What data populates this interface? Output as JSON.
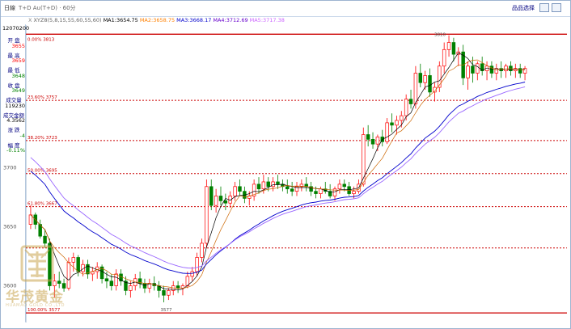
{
  "window": {
    "title_left": "日線",
    "instrument": "T+D  Au(T+D) · 60分",
    "buttons": [
      "品品选择"
    ]
  },
  "sidebar": {
    "date": "12070200",
    "fields": [
      {
        "label": "开 盘",
        "value": "3655",
        "color": "#ff0000"
      },
      {
        "label": "最 高",
        "value": "3659",
        "color": "#ff0000"
      },
      {
        "label": "最 低",
        "value": "3648",
        "color": "#008000"
      },
      {
        "label": "收 盘",
        "value": "3649",
        "color": "#008000"
      },
      {
        "label": "成交量",
        "value": "119230",
        "color": "#000000"
      },
      {
        "label": "成交金额",
        "value": "4.3562",
        "color": "#000000"
      },
      {
        "label": "涨 跌",
        "value": "-4",
        "color": "#008000"
      },
      {
        "label": "幅 度",
        "value": "-0.11%",
        "color": "#008000"
      }
    ]
  },
  "ma_legend": [
    {
      "text": "X",
      "color": "#888888"
    },
    {
      "text": "XYZ8(5,8,15,55,60,55,60)",
      "color": "#666666"
    },
    {
      "text": "MA1:3654.75",
      "color": "#000000"
    },
    {
      "text": "MA2:3658.75",
      "color": "#ff8000"
    },
    {
      "text": "MA3:3668.17",
      "color": "#0000cc"
    },
    {
      "text": "MA4:3712.69",
      "color": "#6600cc"
    },
    {
      "text": "MA5:3717.38",
      "color": "#cc66ff"
    }
  ],
  "watermark": {
    "cn": "华茂黄金",
    "en": "HUAMAO GOLD CO.,LTD"
  },
  "chart_data": {
    "type": "candlestick",
    "ylim": [
      3573,
      3818
    ],
    "yticks": [
      {
        "value": 3700,
        "label": "3700"
      },
      {
        "value": 3650,
        "label": "3650"
      },
      {
        "value": 3600,
        "label": "3600"
      }
    ],
    "high_label": {
      "value": 3810,
      "label": "3810"
    },
    "low_label": {
      "value": 3577,
      "label": "3577"
    },
    "fib_levels": [
      {
        "label": "0.00% 3813",
        "value": 3813,
        "color": "#cc0000"
      },
      {
        "label": "23.60% 3757",
        "value": 3757,
        "color": "#cc0000"
      },
      {
        "label": "38.20% 3723",
        "value": 3723,
        "color": "#cc0000"
      },
      {
        "label": "50.00% 3695",
        "value": 3695,
        "color": "#cc0000"
      },
      {
        "label": "61.80% 3667",
        "value": 3667,
        "color": "#cc0000"
      },
      {
        "label": "100.00% 3577",
        "value": 3577,
        "color": "#cc0000"
      }
    ],
    "grid_lines": [
      3632
    ],
    "colors": {
      "up": "#ff0000",
      "down": "#008000",
      "ma_short": "#000000",
      "ma_mid": "#cc6600",
      "ma_long": "#0000cc",
      "ma_longer": "#9966ff"
    },
    "candles": [
      [
        3652,
        3668,
        3648,
        3660
      ],
      [
        3660,
        3662,
        3648,
        3652
      ],
      [
        3652,
        3656,
        3640,
        3642
      ],
      [
        3642,
        3648,
        3632,
        3636
      ],
      [
        3636,
        3640,
        3596,
        3600
      ],
      [
        3600,
        3610,
        3590,
        3604
      ],
      [
        3604,
        3612,
        3598,
        3602
      ],
      [
        3602,
        3606,
        3595,
        3598
      ],
      [
        3598,
        3624,
        3596,
        3620
      ],
      [
        3620,
        3628,
        3612,
        3624
      ],
      [
        3624,
        3626,
        3608,
        3612
      ],
      [
        3612,
        3622,
        3608,
        3618
      ],
      [
        3618,
        3622,
        3606,
        3610
      ],
      [
        3610,
        3616,
        3604,
        3612
      ],
      [
        3612,
        3620,
        3606,
        3616
      ],
      [
        3616,
        3618,
        3602,
        3606
      ],
      [
        3606,
        3612,
        3598,
        3604
      ],
      [
        3604,
        3610,
        3596,
        3600
      ],
      [
        3600,
        3614,
        3596,
        3610
      ],
      [
        3610,
        3614,
        3600,
        3604
      ],
      [
        3604,
        3608,
        3592,
        3596
      ],
      [
        3596,
        3604,
        3590,
        3600
      ],
      [
        3600,
        3610,
        3596,
        3606
      ],
      [
        3606,
        3612,
        3598,
        3602
      ],
      [
        3602,
        3606,
        3594,
        3598
      ],
      [
        3598,
        3606,
        3594,
        3602
      ],
      [
        3602,
        3608,
        3596,
        3600
      ],
      [
        3600,
        3604,
        3590,
        3596
      ],
      [
        3596,
        3600,
        3586,
        3592
      ],
      [
        3592,
        3598,
        3588,
        3596
      ],
      [
        3596,
        3604,
        3592,
        3600
      ],
      [
        3600,
        3604,
        3594,
        3598
      ],
      [
        3598,
        3602,
        3592,
        3600
      ],
      [
        3600,
        3612,
        3598,
        3608
      ],
      [
        3608,
        3616,
        3604,
        3612
      ],
      [
        3612,
        3628,
        3608,
        3624
      ],
      [
        3624,
        3640,
        3620,
        3636
      ],
      [
        3636,
        3690,
        3632,
        3684
      ],
      [
        3684,
        3690,
        3664,
        3668
      ],
      [
        3668,
        3682,
        3662,
        3676
      ],
      [
        3676,
        3684,
        3668,
        3672
      ],
      [
        3672,
        3678,
        3664,
        3670
      ],
      [
        3670,
        3680,
        3666,
        3676
      ],
      [
        3676,
        3688,
        3672,
        3684
      ],
      [
        3684,
        3690,
        3676,
        3680
      ],
      [
        3680,
        3684,
        3670,
        3674
      ],
      [
        3674,
        3680,
        3668,
        3676
      ],
      [
        3676,
        3690,
        3672,
        3686
      ],
      [
        3686,
        3692,
        3678,
        3682
      ],
      [
        3682,
        3694,
        3678,
        3688
      ],
      [
        3688,
        3692,
        3680,
        3684
      ],
      [
        3684,
        3692,
        3680,
        3688
      ],
      [
        3688,
        3694,
        3682,
        3686
      ],
      [
        3686,
        3690,
        3680,
        3684
      ],
      [
        3684,
        3690,
        3678,
        3682
      ],
      [
        3682,
        3688,
        3676,
        3680
      ],
      [
        3680,
        3688,
        3676,
        3684
      ],
      [
        3684,
        3690,
        3680,
        3686
      ],
      [
        3686,
        3692,
        3680,
        3684
      ],
      [
        3684,
        3688,
        3676,
        3680
      ],
      [
        3680,
        3684,
        3674,
        3678
      ],
      [
        3678,
        3684,
        3674,
        3682
      ],
      [
        3682,
        3688,
        3678,
        3680
      ],
      [
        3680,
        3686,
        3674,
        3676
      ],
      [
        3676,
        3684,
        3672,
        3682
      ],
      [
        3682,
        3690,
        3678,
        3686
      ],
      [
        3686,
        3690,
        3680,
        3684
      ],
      [
        3684,
        3688,
        3676,
        3678
      ],
      [
        3678,
        3684,
        3674,
        3680
      ],
      [
        3680,
        3690,
        3678,
        3686
      ],
      [
        3686,
        3734,
        3684,
        3728
      ],
      [
        3728,
        3736,
        3718,
        3724
      ],
      [
        3724,
        3730,
        3716,
        3720
      ],
      [
        3720,
        3728,
        3714,
        3726
      ],
      [
        3726,
        3732,
        3718,
        3722
      ],
      [
        3722,
        3742,
        3720,
        3738
      ],
      [
        3738,
        3746,
        3730,
        3736
      ],
      [
        3736,
        3744,
        3728,
        3740
      ],
      [
        3740,
        3748,
        3734,
        3744
      ],
      [
        3744,
        3762,
        3740,
        3758
      ],
      [
        3758,
        3766,
        3750,
        3754
      ],
      [
        3754,
        3786,
        3750,
        3780
      ],
      [
        3780,
        3788,
        3768,
        3772
      ],
      [
        3772,
        3782,
        3766,
        3778
      ],
      [
        3778,
        3784,
        3760,
        3764
      ],
      [
        3764,
        3772,
        3756,
        3768
      ],
      [
        3768,
        3790,
        3764,
        3786
      ],
      [
        3786,
        3806,
        3780,
        3800
      ],
      [
        3800,
        3812,
        3794,
        3806
      ],
      [
        3806,
        3810,
        3790,
        3796
      ],
      [
        3796,
        3802,
        3786,
        3798
      ],
      [
        3798,
        3804,
        3770,
        3776
      ],
      [
        3776,
        3790,
        3766,
        3786
      ],
      [
        3786,
        3794,
        3772,
        3780
      ],
      [
        3780,
        3790,
        3774,
        3788
      ],
      [
        3788,
        3794,
        3778,
        3782
      ],
      [
        3782,
        3790,
        3774,
        3786
      ],
      [
        3786,
        3790,
        3776,
        3780
      ],
      [
        3780,
        3788,
        3774,
        3784
      ],
      [
        3784,
        3790,
        3776,
        3782
      ],
      [
        3782,
        3788,
        3776,
        3786
      ],
      [
        3786,
        3790,
        3778,
        3782
      ],
      [
        3782,
        3788,
        3776,
        3784
      ],
      [
        3784,
        3788,
        3776,
        3780
      ],
      [
        3780,
        3786,
        3774,
        3784
      ]
    ]
  }
}
